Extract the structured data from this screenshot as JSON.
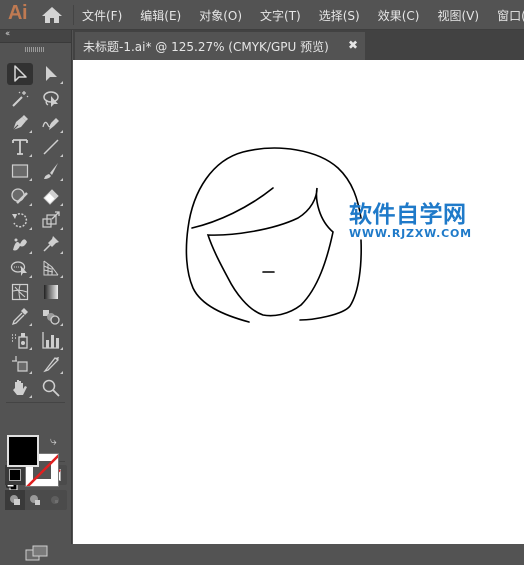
{
  "app": {
    "logo": "Ai",
    "home_icon": "home-icon"
  },
  "menu": {
    "items": [
      "文件(F)",
      "编辑(E)",
      "对象(O)",
      "文字(T)",
      "选择(S)",
      "效果(C)",
      "视图(V)",
      "窗口(W)"
    ]
  },
  "document_tab": {
    "title": "未标题-1.ai* @ 125.27% (CMYK/GPU 预览)",
    "close_label": "✖"
  },
  "toolbar": {
    "collapse_label": "‹‹",
    "tools": [
      {
        "name": "selection-tool",
        "icon": "selection-arrow-icon",
        "active": true
      },
      {
        "name": "direct-selection-tool",
        "icon": "direct-selection-arrow-icon"
      },
      {
        "name": "magic-wand-tool",
        "icon": "magic-wand-icon"
      },
      {
        "name": "lasso-tool",
        "icon": "lasso-icon"
      },
      {
        "name": "pen-tool",
        "icon": "pen-icon"
      },
      {
        "name": "curvature-tool",
        "icon": "curvature-pen-icon"
      },
      {
        "name": "type-tool",
        "icon": "type-icon"
      },
      {
        "name": "line-segment-tool",
        "icon": "line-icon"
      },
      {
        "name": "rectangle-tool",
        "icon": "rectangle-icon"
      },
      {
        "name": "paintbrush-tool",
        "icon": "paintbrush-icon"
      },
      {
        "name": "shaper-tool",
        "icon": "shaper-icon"
      },
      {
        "name": "eraser-tool",
        "icon": "eraser-icon"
      },
      {
        "name": "rotate-tool",
        "icon": "rotate-icon"
      },
      {
        "name": "scale-tool",
        "icon": "scale-icon"
      },
      {
        "name": "puppet-warp-tool",
        "icon": "puppet-warp-icon"
      },
      {
        "name": "pin-tool",
        "icon": "pin-icon"
      },
      {
        "name": "shape-builder-tool",
        "icon": "shape-builder-icon"
      },
      {
        "name": "perspective-grid-tool",
        "icon": "perspective-grid-icon"
      },
      {
        "name": "mesh-tool",
        "icon": "mesh-icon"
      },
      {
        "name": "gradient-tool",
        "icon": "gradient-icon"
      },
      {
        "name": "eyedropper-tool",
        "icon": "eyedropper-icon"
      },
      {
        "name": "blend-tool",
        "icon": "blend-icon"
      },
      {
        "name": "symbol-sprayer-tool",
        "icon": "symbol-sprayer-icon"
      },
      {
        "name": "column-graph-tool",
        "icon": "column-graph-icon"
      },
      {
        "name": "artboard-tool",
        "icon": "artboard-icon"
      },
      {
        "name": "slice-tool",
        "icon": "slice-icon"
      },
      {
        "name": "hand-tool",
        "icon": "hand-icon"
      },
      {
        "name": "zoom-tool",
        "icon": "zoom-icon"
      }
    ],
    "fill_color": "#000000",
    "stroke_color": "none",
    "color_modes": [
      "color",
      "gradient",
      "none"
    ],
    "draw_modes": [
      "draw-normal",
      "draw-behind",
      "draw-inside"
    ]
  },
  "canvas": {
    "background": "#ffffff",
    "artwork": "hair-and-face-line-drawing"
  },
  "watermark": {
    "title": "软件自学网",
    "url": "WWW.RJZXW.COM",
    "color": "#1f7ac9"
  }
}
